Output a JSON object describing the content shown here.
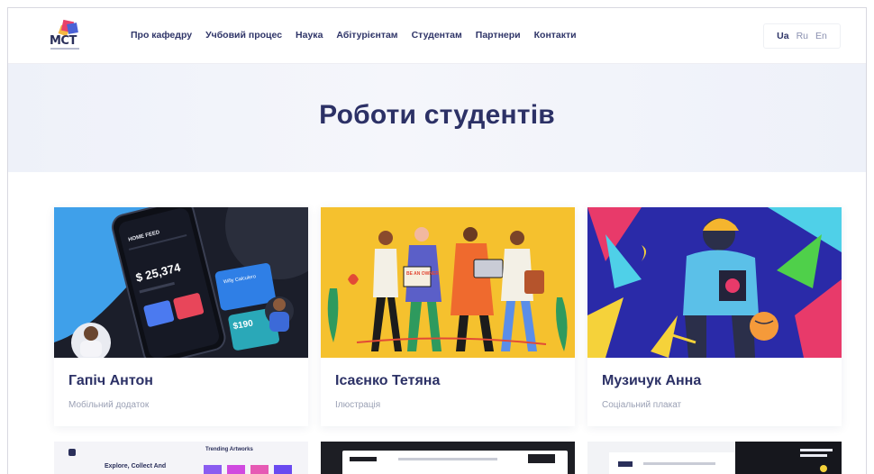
{
  "header": {
    "logo_text": "MCT",
    "nav": [
      "Про кафедру",
      "Учбовий процес",
      "Наука",
      "Абітурієнтам",
      "Студентам",
      "Партнери",
      "Контакти"
    ],
    "lang": {
      "active": "Ua",
      "others": [
        "Ru",
        "En"
      ]
    }
  },
  "hero": {
    "title": "Роботи студентів"
  },
  "cards": [
    {
      "name": "Гапіч Антон",
      "category": "Мобільний додаток",
      "img_text": {
        "balance": "$ 25,374",
        "wallet": "Willy Calculero",
        "amount": "$190",
        "screen": "HOME FEED"
      }
    },
    {
      "name": "Ісаєнко Тетяна",
      "category": "Ілюстрація",
      "img_text": {
        "sign": "BE AN OWNER"
      }
    },
    {
      "name": "Музичук Анна",
      "category": "Соціальний плакат"
    }
  ],
  "row2": {
    "card1": {
      "heading": "Trending Artworks",
      "subheading": "Explore, Collect And"
    }
  },
  "colors": {
    "text": "#2c3166",
    "muted": "#9aa0b4",
    "accent": "#2f3568"
  }
}
